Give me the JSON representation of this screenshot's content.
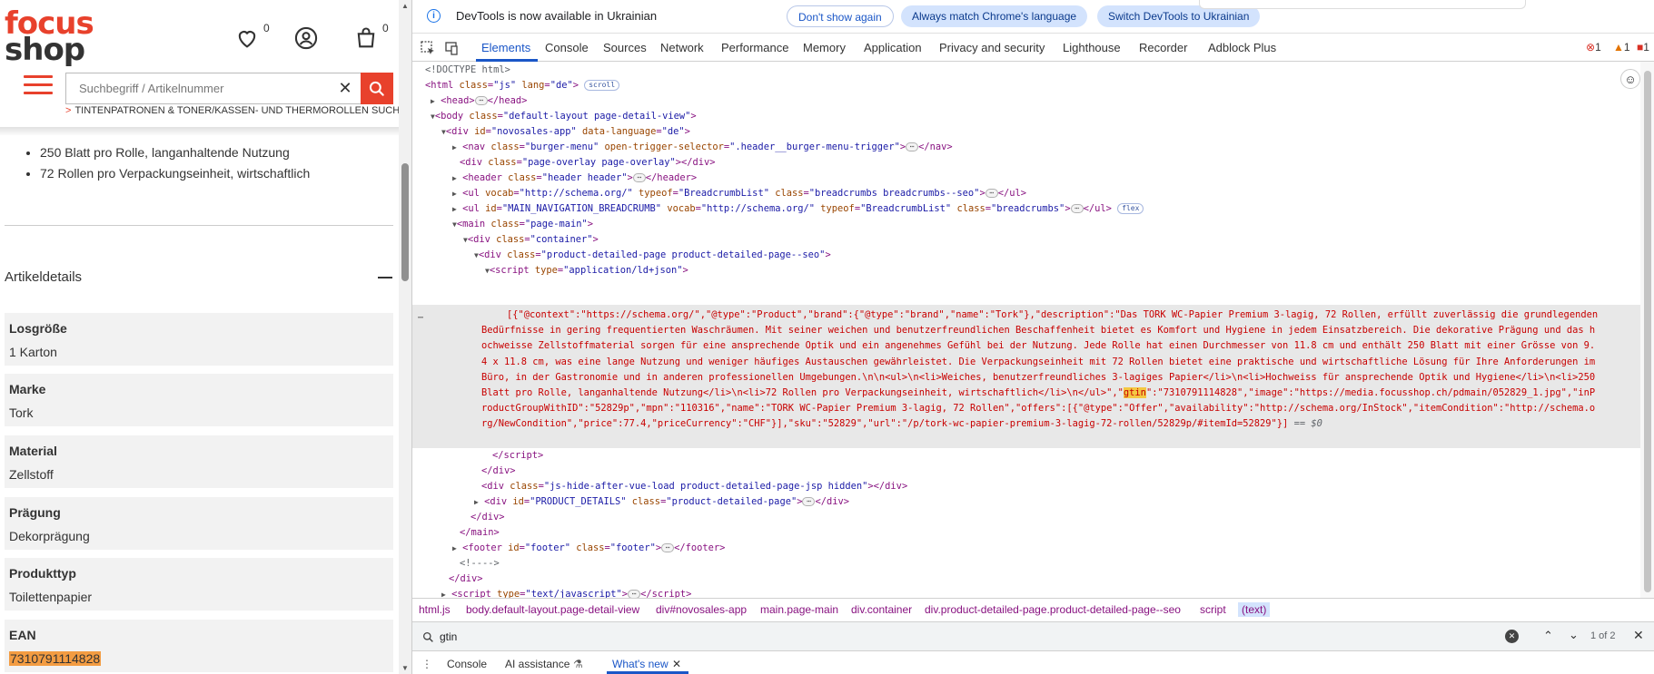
{
  "shop": {
    "logo_top": "focus",
    "logo_bottom": "shop",
    "wishlist_count": "0",
    "cart_count": "0",
    "search_placeholder": "Suchbegriff / Artikelnummer",
    "search_hint": "TINTENPATRONEN & TONER/KASSEN- UND THERMOROLLEN SUCHEN",
    "bullets": [
      "250 Blatt pro Rolle, langanhaltende Nutzung",
      "72 Rollen pro Verpackungseinheit, wirtschaftlich"
    ],
    "section_title": "Artikeldetails",
    "details": [
      {
        "label": "Losgröße",
        "value": "1 Karton"
      },
      {
        "label": "Marke",
        "value": "Tork"
      },
      {
        "label": "Material",
        "value": "Zellstoff"
      },
      {
        "label": "Prägung",
        "value": "Dekorprägung"
      },
      {
        "label": "Produkttyp",
        "value": "Toilettenpapier"
      },
      {
        "label": "EAN",
        "value": "7310791114828"
      }
    ]
  },
  "devtools": {
    "infobar": {
      "text": "DevTools is now available in Ukrainian",
      "btn_dont_show": "Don't show again",
      "btn_match": "Always match Chrome's language",
      "btn_switch": "Switch DevTools to Ukrainian"
    },
    "tabs": [
      "Elements",
      "Console",
      "Sources",
      "Network",
      "Performance",
      "Memory",
      "Application",
      "Privacy and security",
      "Lighthouse",
      "Recorder",
      "Adblock Plus"
    ],
    "errors": "1",
    "warnings": "1",
    "issues": "1",
    "dom": {
      "doctype": "<!DOCTYPE html>",
      "scroll_chip": "scroll",
      "flex_chip": "flex",
      "dollar0": "== $0"
    },
    "json_ld": {
      "before": "[{\"@context\":\"https://schema.org/\",\"@type\":\"Product\",\"brand\":{\"@type\":\"brand\",\"name\":\"Tork\"},\"description\":\"Das TORK WC-Papier Premium 3-lagig, 72 Rollen, erfüllt zuverlässig die grundlegenden Bedürfnisse in gering frequentierten Waschräumen. Mit seiner weichen und benutzerfreundlichen Beschaffenheit bietet es Komfort und Hygiene in jedem Einsatzbereich. Die dekorative Prägung und das hochweisse Zellstoffmaterial sorgen für eine ansprechende Optik und ein angenehmes Gefühl bei der Nutzung. Jede Rolle hat einen Durchmesser von 11.8 cm und enthält 250 Blatt mit einer Grösse von 9.4 x 11.8 cm, was eine lange Nutzung und weniger häufiges Austauschen gewährleistet. Die Verpackungseinheit mit 72 Rollen bietet eine praktische und wirtschaftliche Lösung für Ihre Anforderungen im Büro, in der Gastronomie und in anderen professionellen Umgebungen.\\n\\n<ul>\\n<li>Weiches, benutzerfreundliches 3-lagiges Papier</li>\\n<li>Hochweiss für ansprechende Optik und Hygiene</li>\\n<li>250 Blatt pro Rolle, langanhaltende Nutzung</li>\\n<li>72 Rollen pro Verpackungseinheit, wirtschaftlich</li>\\n</ul>\",\"",
      "match": "gtin",
      "after": "\":\"7310791114828\",\"image\":\"https://media.focusshop.ch/pdmain/052829_1.jpg\",\"inProductGroupWithID\":\"52829p\",\"mpn\":\"110316\",\"name\":\"TORK WC-Papier Premium  3-lagig, 72 Rollen\",\"offers\":[{\"@type\":\"Offer\",\"availability\":\"http://schema.org/InStock\",\"itemCondition\":\"http://schema.org/NewCondition\",\"price\":77.4,\"priceCurrency\":\"CHF\"}],\"sku\":\"52829\",\"url\":\"/p/tork-wc-papier-premium-3-lagig-72-rollen/52829p/#itemId=52829\"}]"
    },
    "breadcrumbs": [
      "html.js",
      "body.default-layout.page-detail-view",
      "div#novosales-app",
      "main.page-main",
      "div.container",
      "div.product-detailed-page.product-detailed-page--seo",
      "script",
      "(text)"
    ],
    "find": {
      "query": "gtin",
      "count": "1 of 2"
    },
    "drawer": {
      "console": "Console",
      "ai": "AI assistance",
      "whats_new": "What's new"
    }
  }
}
